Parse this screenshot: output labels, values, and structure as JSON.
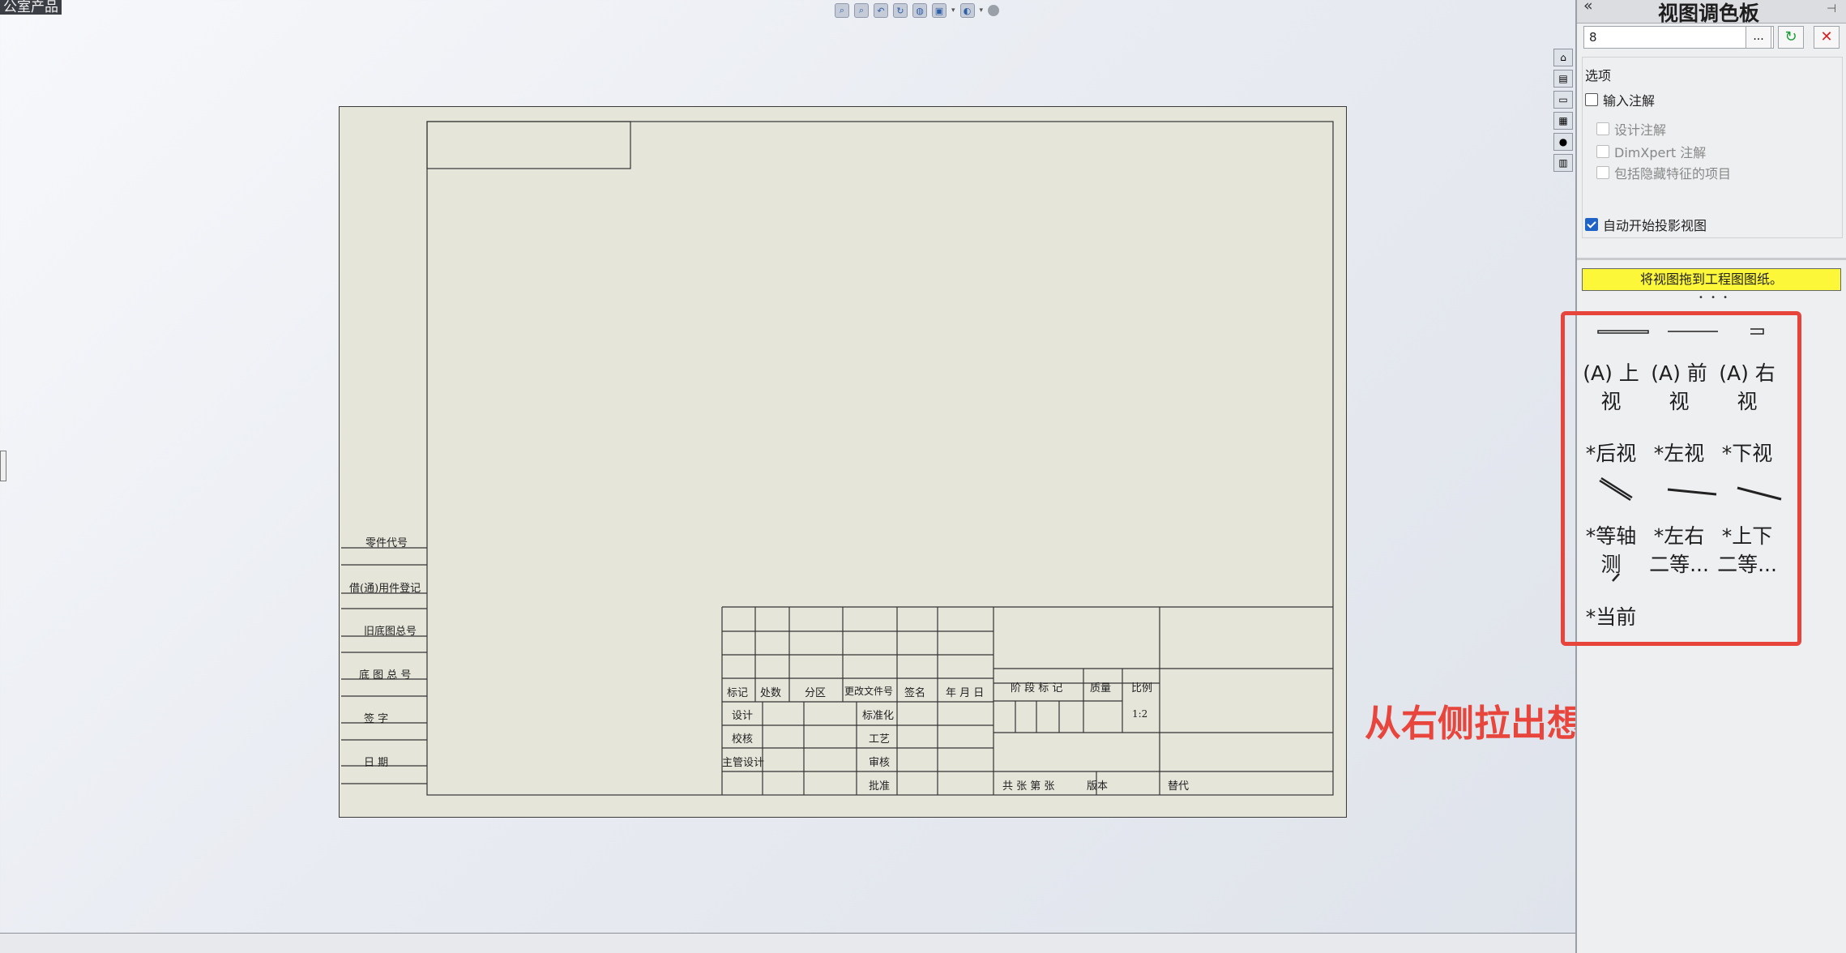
{
  "document_tab": "公室产品",
  "heads_up_icons": [
    "zoom-to-fit-icon",
    "zoom-area-icon",
    "previous-view-icon",
    "rotate-icon",
    "display-style-icon",
    "view-orientation-icon",
    "hide-show-icon",
    "appearance-icon"
  ],
  "title_block": {
    "left_column": [
      "零件代号",
      "借(通)用件登记",
      "旧底图总号",
      "底 图 总 号",
      "签 字",
      "日 期"
    ],
    "rev_headers": [
      "标记",
      "处数",
      "分区",
      "更改文件号",
      "签名",
      "年 月 日"
    ],
    "sign_rows": [
      {
        "left": "设计",
        "right": "标准化"
      },
      {
        "left": "校核",
        "right": "工艺"
      },
      {
        "left": "主管设计",
        "right": "审核"
      },
      {
        "left": "",
        "right": "批准"
      }
    ],
    "stage_mark": "阶 段 标 记",
    "mass": "质量",
    "scale": "比例",
    "scale_value": "1:2",
    "sheets": "共 张 第 张",
    "version": "版本",
    "replace": "替代"
  },
  "panel": {
    "title": "视图调色板",
    "dropdown_value": "8",
    "ellipsis": "...",
    "options_label": "选项",
    "checkboxes": [
      {
        "label": "输入注解",
        "checked": false,
        "disabled": false
      },
      {
        "label": "设计注解",
        "checked": false,
        "disabled": true
      },
      {
        "label": "DimXpert 注解",
        "checked": false,
        "disabled": true
      },
      {
        "label": "包括隐藏特征的项目",
        "checked": false,
        "disabled": true
      },
      {
        "label": "自动开始投影视图",
        "checked": true,
        "disabled": false
      }
    ],
    "hint": "将视图拖到工程图图纸。",
    "views": [
      {
        "line1": "(A) 上",
        "line2": "视"
      },
      {
        "line1": "(A) 前",
        "line2": "视"
      },
      {
        "line1": "(A) 右",
        "line2": "视"
      },
      {
        "line1": "*后视",
        "line2": ""
      },
      {
        "line1": "*左视",
        "line2": ""
      },
      {
        "line1": "*下视",
        "line2": ""
      },
      {
        "line1": "*等轴",
        "line2": "测"
      },
      {
        "line1": "*左右",
        "line2": "二等..."
      },
      {
        "line1": "*上下",
        "line2": "二等..."
      },
      {
        "line1": "*当前",
        "line2": ""
      }
    ]
  },
  "annotation": "从右侧拉出想要的视图"
}
